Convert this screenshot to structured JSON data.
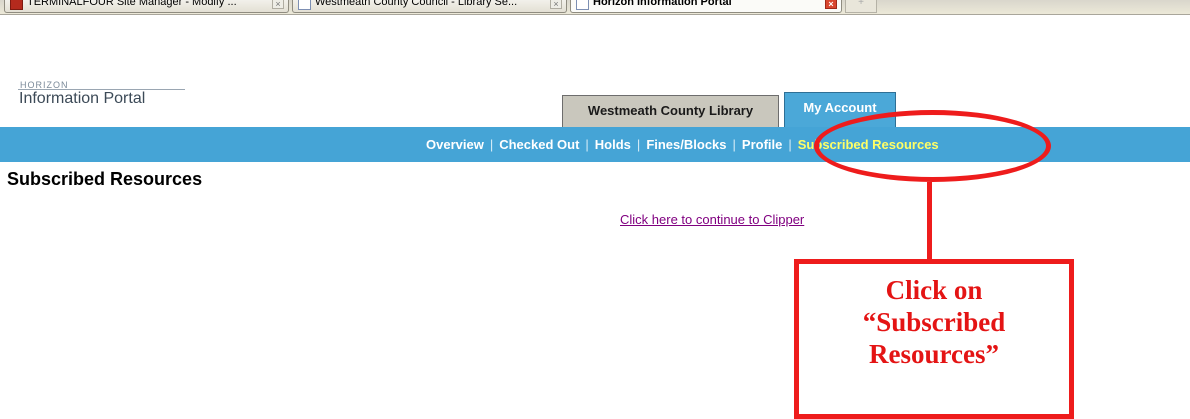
{
  "browser": {
    "tabs": [
      {
        "label": "TERMINALFOUR Site Manager - Modify ...",
        "active": false
      },
      {
        "label": "Westmeath County Council - Library Se...",
        "active": false
      },
      {
        "label": "Horizon Information Portal",
        "active": true
      }
    ]
  },
  "portal": {
    "logo_small": "HORIZON",
    "logo_main": "Information Portal",
    "tabs": [
      {
        "label": "Westmeath County Library"
      },
      {
        "label": "My Account"
      }
    ],
    "nav": {
      "items": [
        "Overview",
        "Checked Out",
        "Holds",
        "Fines/Blocks",
        "Profile",
        "Subscribed Resources"
      ],
      "separator": "|",
      "current": "Subscribed Resources"
    },
    "heading": "Subscribed Resources",
    "link": "Click here to continue to Clipper"
  },
  "annotation": {
    "callout_text": "Click on\n“Subscribed\nResources”",
    "color": "#ee1c1c"
  },
  "colors": {
    "nav_bar": "#45a4d6",
    "nav_current": "#ffff66",
    "link_visited": "#800080"
  }
}
